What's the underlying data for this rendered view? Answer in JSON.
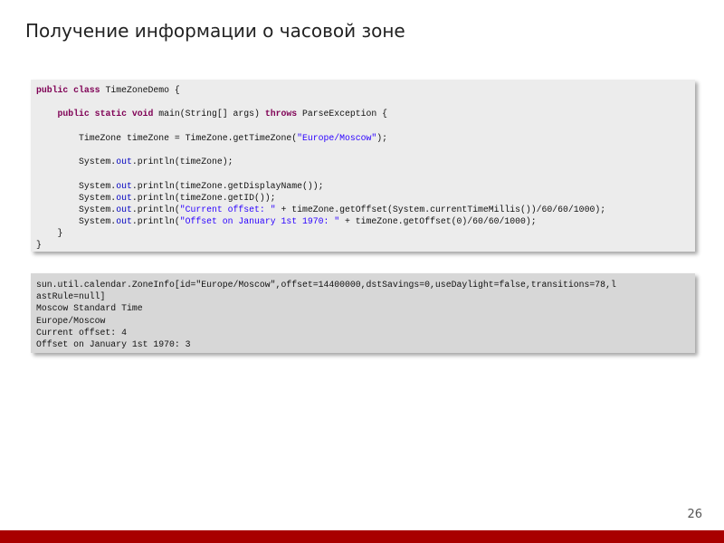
{
  "slide": {
    "title": "Получение информации о часовой зоне",
    "page_number": "26"
  },
  "code": {
    "language": "java",
    "colors": {
      "keyword": "#7f0055",
      "string": "#2a00ff",
      "field": "#0000c0",
      "text": "#111111"
    },
    "lines": [
      [
        {
          "t": "public class",
          "k": "kw"
        },
        {
          "t": " TimeZoneDemo {"
        }
      ],
      [],
      [
        {
          "t": "    "
        },
        {
          "t": "public static void",
          "k": "kw"
        },
        {
          "t": " main(String[] args) "
        },
        {
          "t": "throws",
          "k": "kw"
        },
        {
          "t": " ParseException {"
        }
      ],
      [],
      [
        {
          "t": "        TimeZone timeZone = TimeZone.getTimeZone("
        },
        {
          "t": "\"Europe/Moscow\"",
          "k": "str"
        },
        {
          "t": ");"
        }
      ],
      [],
      [
        {
          "t": "        System."
        },
        {
          "t": "out",
          "k": "fld"
        },
        {
          "t": ".println(timeZone);"
        }
      ],
      [],
      [
        {
          "t": "        System."
        },
        {
          "t": "out",
          "k": "fld"
        },
        {
          "t": ".println(timeZone.getDisplayName());"
        }
      ],
      [
        {
          "t": "        System."
        },
        {
          "t": "out",
          "k": "fld"
        },
        {
          "t": ".println(timeZone.getID());"
        }
      ],
      [
        {
          "t": "        System."
        },
        {
          "t": "out",
          "k": "fld"
        },
        {
          "t": ".println("
        },
        {
          "t": "\"Current offset: \"",
          "k": "str"
        },
        {
          "t": " + timeZone.getOffset(System.currentTimeMillis())/60/60/1000);"
        }
      ],
      [
        {
          "t": "        System."
        },
        {
          "t": "out",
          "k": "fld"
        },
        {
          "t": ".println("
        },
        {
          "t": "\"Offset on January 1st 1970: \"",
          "k": "str"
        },
        {
          "t": " + timeZone.getOffset(0)/60/60/1000);"
        }
      ],
      [
        {
          "t": "    }"
        }
      ],
      [
        {
          "t": "}"
        }
      ]
    ]
  },
  "output": {
    "lines": [
      "sun.util.calendar.ZoneInfo[id=\"Europe/Moscow\",offset=14400000,dstSavings=0,useDaylight=false,transitions=78,l",
      "astRule=null]",
      "Moscow Standard Time",
      "Europe/Moscow",
      "Current offset: 4",
      "Offset on January 1st 1970: 3"
    ]
  },
  "theme": {
    "footer_bar_color": "#a80000",
    "code_background": "#ececec",
    "output_background": "#d7d7d7"
  }
}
